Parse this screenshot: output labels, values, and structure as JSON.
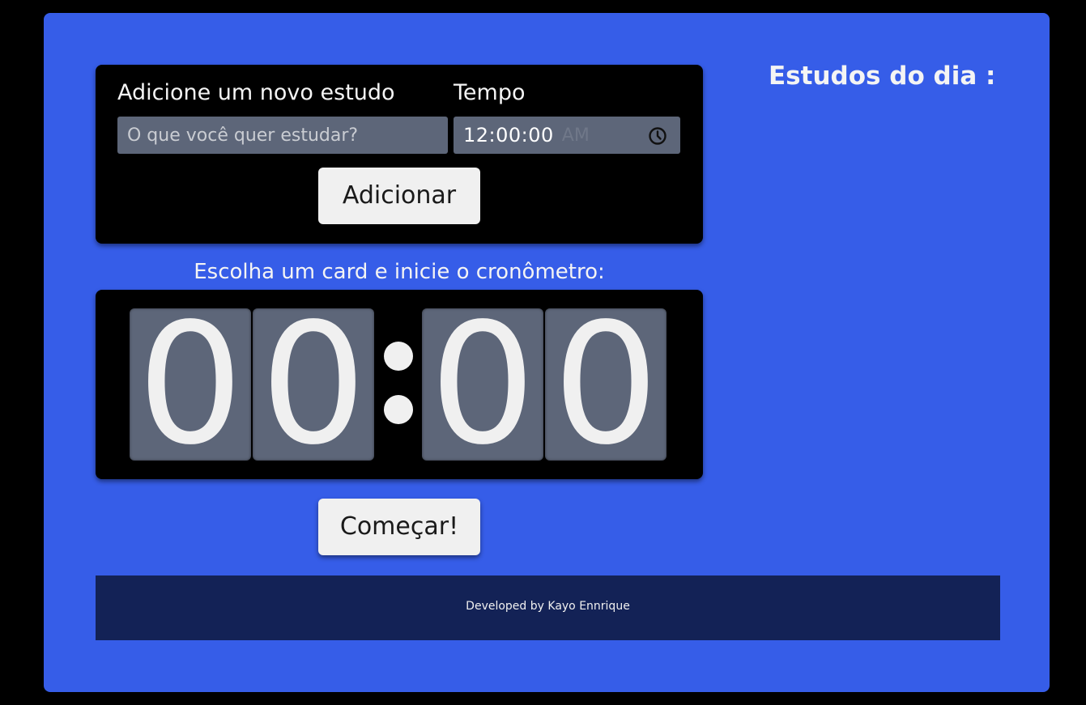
{
  "form": {
    "study_label": "Adicione um novo estudo",
    "time_label": "Tempo",
    "study_placeholder": "O que você quer estudar?",
    "time_value": "12:00:00",
    "time_ampm": "AM",
    "add_button": "Adicionar"
  },
  "timer": {
    "instruction": "Escolha um card e inicie o cronômetro:",
    "digits": [
      "0",
      "0",
      "0",
      "0"
    ],
    "start_button": "Começar!"
  },
  "sidebar": {
    "heading": "Estudos do dia :"
  },
  "footer": {
    "text": "Developed by Kayo Ennrique"
  },
  "icons": {
    "time_picker": "clock-icon"
  },
  "colors": {
    "page_background": "#000000",
    "panel": "#365de8",
    "card": "#000000",
    "field": "#5d6679",
    "button": "#f0f0f0",
    "footer": "#132256"
  }
}
